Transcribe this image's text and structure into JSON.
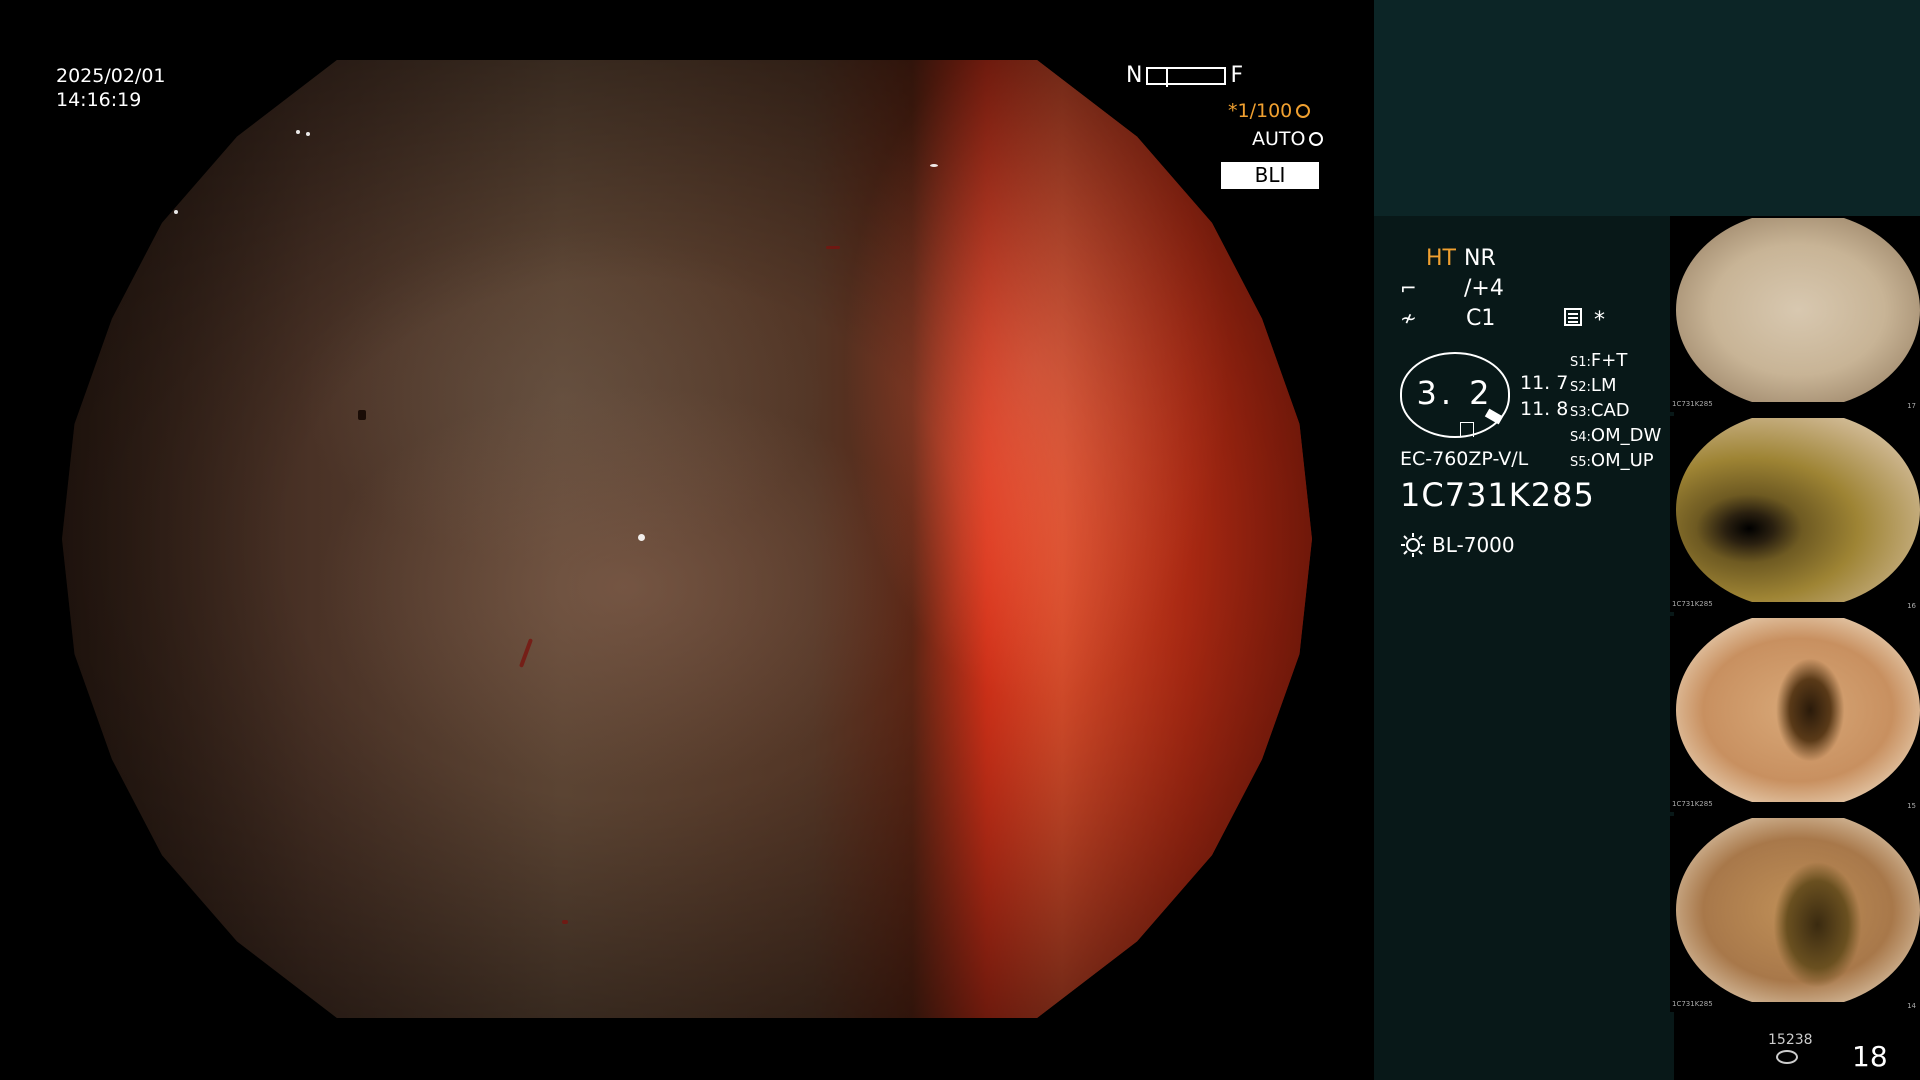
{
  "overlay": {
    "date": "2025/02/01",
    "time": "14:16:19",
    "nf_near": "N",
    "nf_far": "F",
    "shutter": "*1/100",
    "iris": "AUTO",
    "mode": "BLI"
  },
  "side": {
    "ht": "HT",
    "nr": "NR",
    "enhancement": "/+4",
    "color": "C1",
    "star": "*",
    "gauge_value": "3. 2",
    "value_a": "11. 7",
    "value_b": "11. 8",
    "switches": [
      {
        "key": "S1",
        "value": "F+T"
      },
      {
        "key": "S2",
        "value": "LM"
      },
      {
        "key": "S3",
        "value": "CAD"
      },
      {
        "key": "S4",
        "value": "OM_DW"
      },
      {
        "key": "S5",
        "value": "OM_UP"
      }
    ],
    "scope_model": "EC-760ZP-V/L",
    "serial": "1C731K285",
    "light_source": "BL-7000"
  },
  "thumbnails": [
    {
      "caption": "1C731K285",
      "num": "17"
    },
    {
      "caption": "1C731K285",
      "num": "16"
    },
    {
      "caption": "1C731K285",
      "num": "15"
    },
    {
      "caption": "1C731K285",
      "num": "14"
    }
  ],
  "footer": {
    "count_small": "15238",
    "count_big": "18"
  },
  "colors": {
    "accent_orange": "#f0a030",
    "panel_top": "#0c2526",
    "panel_info": "#081818"
  },
  "icons": [
    "enhancement-icon",
    "color-icon",
    "menu-icon",
    "light-source-icon",
    "disk-icon",
    "shutter-icon",
    "iris-icon"
  ]
}
